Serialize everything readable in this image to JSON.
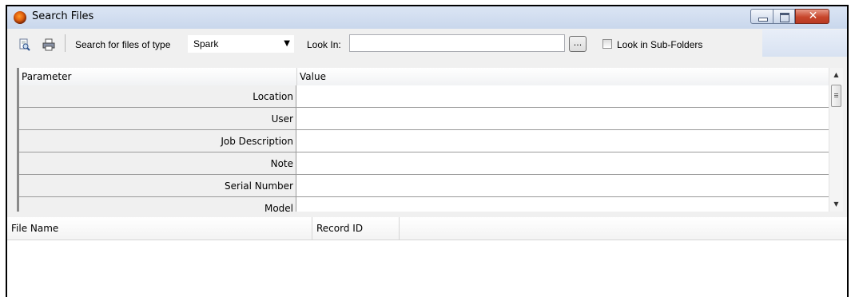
{
  "window": {
    "title": "Search Files",
    "close_glyph": "✕"
  },
  "toolbar": {
    "search_type_label": "Search for files of type",
    "search_type_value": "Spark",
    "look_in_label": "Look In:",
    "look_in_value": "",
    "browse_label": "...",
    "subfolders_label": "Look in Sub-Folders",
    "subfolders_checked": false,
    "icons": [
      "find-icon",
      "print-icon"
    ]
  },
  "grid": {
    "columns": [
      "Parameter",
      "Value"
    ],
    "rows": [
      {
        "parameter": "Location",
        "value": ""
      },
      {
        "parameter": "User",
        "value": ""
      },
      {
        "parameter": "Job Description",
        "value": ""
      },
      {
        "parameter": "Note",
        "value": ""
      },
      {
        "parameter": "Serial Number",
        "value": ""
      },
      {
        "parameter": "Model",
        "value": ""
      }
    ]
  },
  "results": {
    "columns": [
      "File Name",
      "Record ID"
    ],
    "rows": []
  }
}
